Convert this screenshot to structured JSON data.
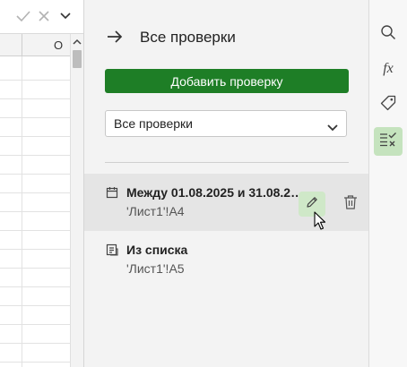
{
  "sheet": {
    "column_letter": "O"
  },
  "panel": {
    "title": "Все проверки",
    "add_button_label": "Добавить проверку",
    "filter_value": "Все проверки",
    "rules": [
      {
        "title": "Между 01.08.2025 и 31.08.2…",
        "range": "'Лист1'!A4",
        "icon": "calendar-icon"
      },
      {
        "title": "Из списка",
        "range": "'Лист1'!A5",
        "icon": "list-icon"
      }
    ]
  },
  "toolbar": {
    "fx_label": "fx",
    "items": [
      "search-icon",
      "function-icon",
      "tag-icon",
      "data-validation-icon"
    ]
  },
  "colors": {
    "accent_green": "#1e7e26",
    "active_tool_bg": "#c5e3be",
    "edit_button_bg": "#cfe8c8",
    "panel_bg": "#f3f3f3"
  }
}
